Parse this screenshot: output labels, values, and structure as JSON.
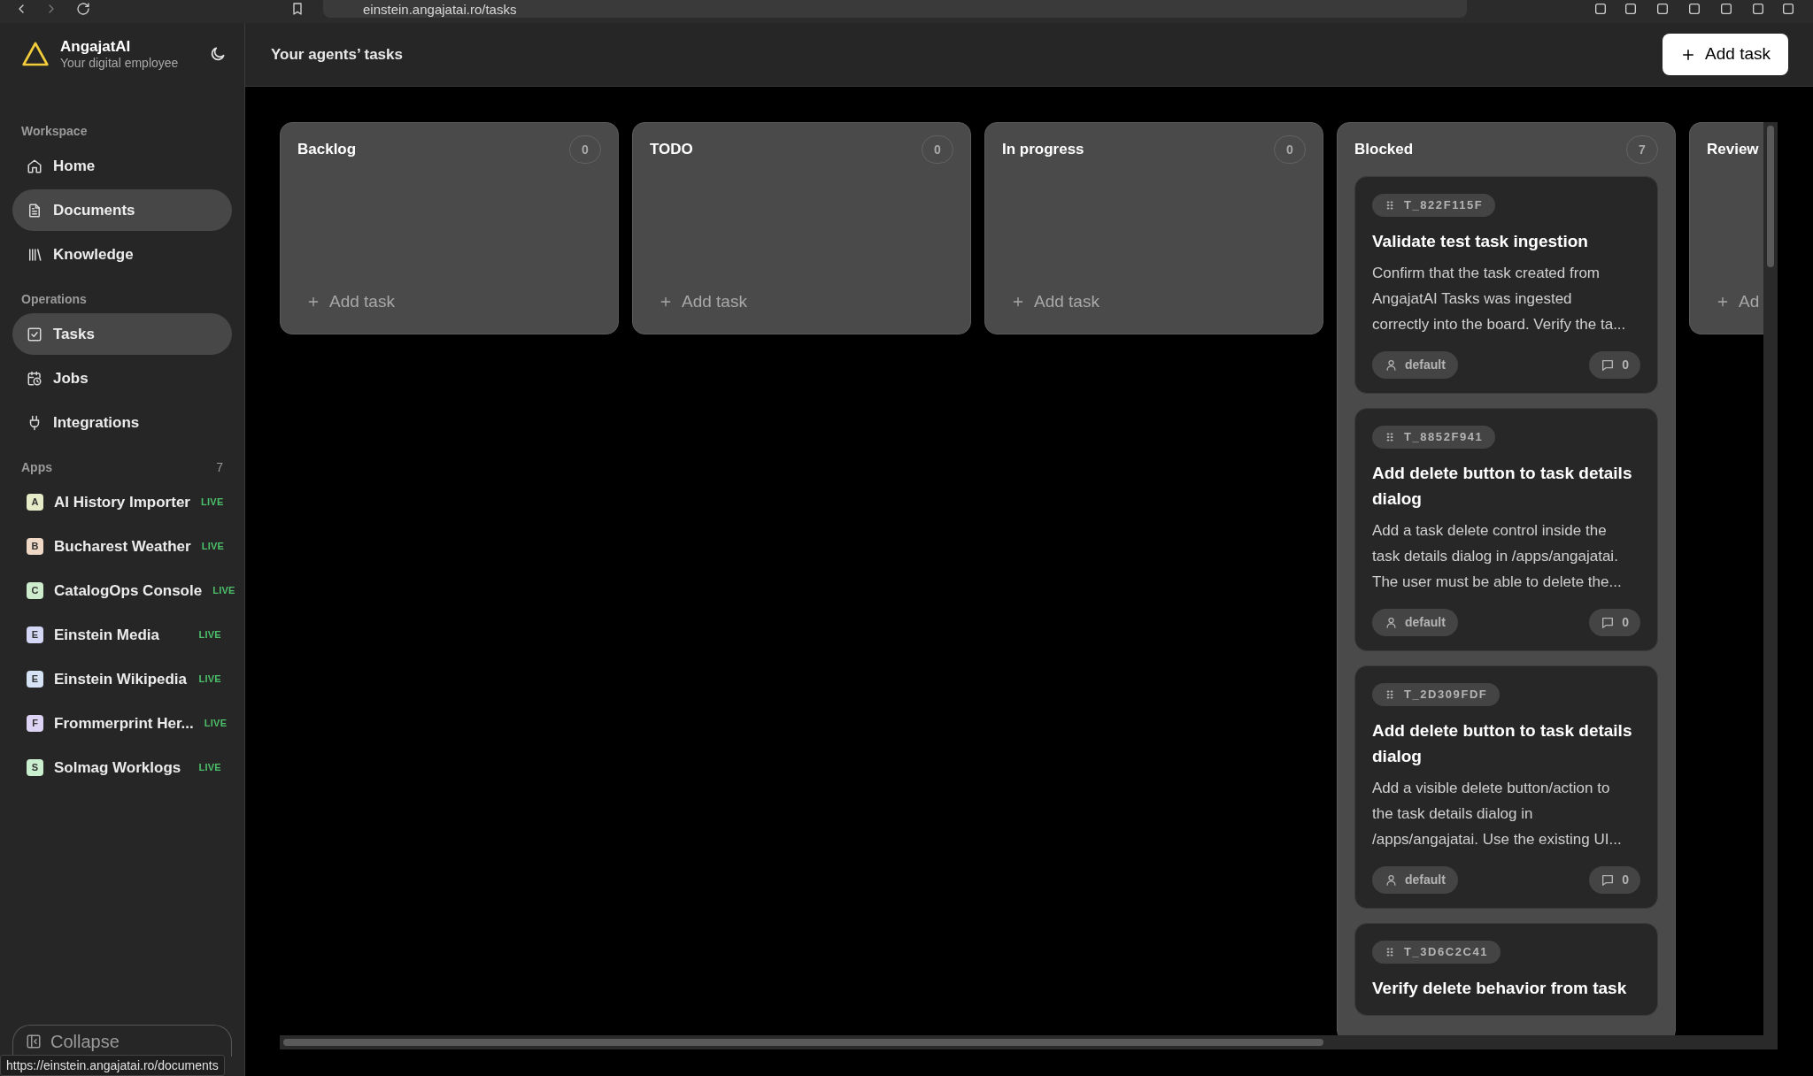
{
  "browser": {
    "url": "einstein.angajatai.ro/tasks"
  },
  "sidebar": {
    "brand": "AngajatAI",
    "tagline": "Your digital employee",
    "sections": [
      {
        "label": "Workspace",
        "items": [
          {
            "label": "Home",
            "highlighted": false
          },
          {
            "label": "Documents",
            "highlighted": true
          },
          {
            "label": "Knowledge",
            "highlighted": false
          }
        ]
      },
      {
        "label": "Operations",
        "items": [
          {
            "label": "Tasks",
            "highlighted": true
          },
          {
            "label": "Jobs",
            "highlighted": false
          },
          {
            "label": "Integrations",
            "highlighted": false
          }
        ]
      }
    ],
    "apps": {
      "label": "Apps",
      "count": "7",
      "items": [
        {
          "letter": "A",
          "name": "AI History Importer",
          "status": "LIVE",
          "color": "#e4ebc6"
        },
        {
          "letter": "B",
          "name": "Bucharest Weather",
          "status": "LIVE",
          "color": "#f0d8c6"
        },
        {
          "letter": "C",
          "name": "CatalogOps Console",
          "status": "LIVE",
          "color": "#cdeccb"
        },
        {
          "letter": "E",
          "name": "Einstein Media",
          "status": "LIVE",
          "color": "#d3d7f5"
        },
        {
          "letter": "E",
          "name": "Einstein Wikipedia",
          "status": "LIVE",
          "color": "#d5e3f5"
        },
        {
          "letter": "F",
          "name": "Frommerprint Her...",
          "status": "LIVE",
          "color": "#dcd3f5"
        },
        {
          "letter": "S",
          "name": "Solmag Worklogs",
          "status": "LIVE",
          "color": "#c9efcf"
        }
      ]
    },
    "collapse_label": "Collapse"
  },
  "header": {
    "title": "Your agents’ tasks",
    "add_button": "Add task"
  },
  "columns": [
    {
      "title": "Backlog",
      "count": "0",
      "add_label": "Add task"
    },
    {
      "title": "TODO",
      "count": "0",
      "add_label": "Add task"
    },
    {
      "title": "In progress",
      "count": "0",
      "add_label": "Add task"
    },
    {
      "title": "Blocked",
      "count": "7",
      "tasks": [
        {
          "id": "T_822F115F",
          "title": "Validate test task ingestion",
          "description": "Confirm that the task created from AngajatAI Tasks was ingested correctly into the board. Verify the ta...",
          "assignee": "default",
          "comments": "0"
        },
        {
          "id": "T_8852F941",
          "title": "Add delete button to task details dialog",
          "description": "Add a task delete control inside the task details dialog in /apps/angajatai. The user must be able to delete the...",
          "assignee": "default",
          "comments": "0"
        },
        {
          "id": "T_2D309FDF",
          "title": "Add delete button to task details dialog",
          "description": "Add a visible delete button/action to the task details dialog in /apps/angajatai. Use the existing UI...",
          "assignee": "default",
          "comments": "0"
        },
        {
          "id": "T_3D6C2C41",
          "title": "Verify delete behavior from task"
        }
      ]
    },
    {
      "title": "Review",
      "add_label": "Ad"
    }
  ],
  "status_tooltip": "https://einstein.angajatai.ro/documents"
}
